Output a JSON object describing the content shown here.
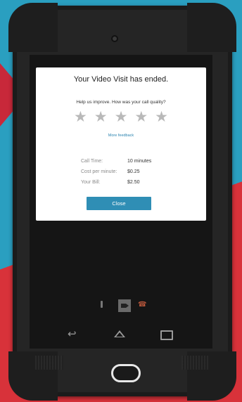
{
  "dialog": {
    "title": "Your Video Visit has ended.",
    "rating_prompt": "Help us improve. How was your call quality?",
    "rating": 0,
    "rating_max": 5,
    "star_glyph": "★",
    "more_feedback_link": "More feedback",
    "stats": [
      {
        "label": "Call Time:",
        "value": "10 minutes"
      },
      {
        "label": "Cost per minute:",
        "value": "$0.25"
      },
      {
        "label": "Your Bill:",
        "value": "$2.50"
      }
    ],
    "close_button": "Close"
  },
  "call_controls": {
    "mic_icon": "mic-icon",
    "video_icon": "video-camera-icon",
    "end_call_icon": "phone-hangup-icon",
    "end_call_glyph": "☎"
  },
  "navbar": {
    "back_icon": "back-icon",
    "back_glyph": "↩",
    "home_icon": "home-icon",
    "recents_icon": "recent-apps-icon"
  },
  "colors": {
    "accent": "#2f8eb5",
    "link": "#2b84b0",
    "star_empty": "#b9b9b9",
    "background_blue": "#2a9fc0",
    "background_red": "#d8323a"
  }
}
